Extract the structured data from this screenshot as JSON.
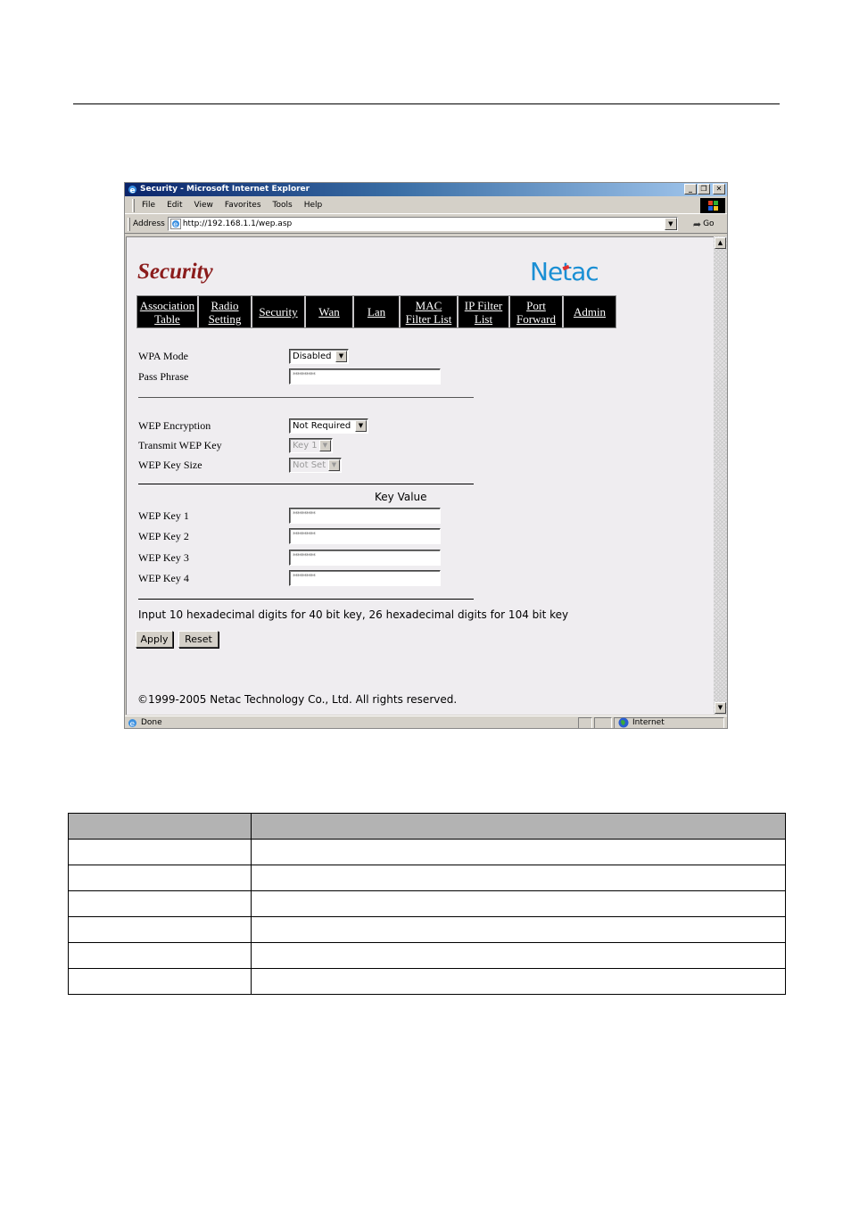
{
  "browser": {
    "window_title": "Security - Microsoft Internet Explorer",
    "window_buttons": [
      "minimize",
      "restore",
      "close"
    ],
    "menu": [
      "File",
      "Edit",
      "View",
      "Favorites",
      "Tools",
      "Help"
    ],
    "address_label": "Address",
    "url": "http://192.168.1.1/wep.asp",
    "go_label": "Go",
    "status_text": "Done",
    "zone_label": "Internet"
  },
  "page": {
    "title": "Security",
    "brand": "Netac",
    "nav": [
      {
        "line1": "Association",
        "line2": "Table"
      },
      {
        "line1": "Radio",
        "line2": "Setting"
      },
      {
        "line1": "Security",
        "line2": ""
      },
      {
        "line1": "Wan",
        "line2": ""
      },
      {
        "line1": "Lan",
        "line2": ""
      },
      {
        "line1": "MAC",
        "line2": "Filter List"
      },
      {
        "line1": "IP Filter",
        "line2": "List"
      },
      {
        "line1": "Port",
        "line2": "Forward"
      },
      {
        "line1": "Admin",
        "line2": ""
      }
    ],
    "wpa_mode": {
      "label": "WPA Mode",
      "value": "Disabled"
    },
    "pass_phrase": {
      "label": "Pass Phrase",
      "value": "**********"
    },
    "wep_encryption": {
      "label": "WEP Encryption",
      "value": "Not Required"
    },
    "transmit_wep_key": {
      "label": "Transmit WEP Key",
      "value": "Key 1",
      "disabled": true
    },
    "wep_key_size": {
      "label": "WEP Key Size",
      "value": "Not Set",
      "disabled": true
    },
    "key_value_header": "Key Value",
    "wep_keys": [
      {
        "label": "WEP Key 1",
        "value": "**********"
      },
      {
        "label": "WEP Key 2",
        "value": "**********"
      },
      {
        "label": "WEP Key 3",
        "value": "**********"
      },
      {
        "label": "WEP Key 4",
        "value": "**********"
      }
    ],
    "hint": "Input 10 hexadecimal digits for 40 bit key, 26 hexadecimal digits for 104 bit key",
    "apply_label": "Apply",
    "reset_label": "Reset",
    "copyright": "©1999-2005 Netac Technology Co., Ltd. All rights reserved."
  },
  "doc_table": {
    "headers": [
      "",
      ""
    ],
    "rows": [
      [
        "",
        ""
      ],
      [
        "",
        ""
      ],
      [
        "",
        ""
      ],
      [
        "",
        ""
      ],
      [
        "",
        ""
      ],
      [
        "",
        ""
      ]
    ]
  }
}
